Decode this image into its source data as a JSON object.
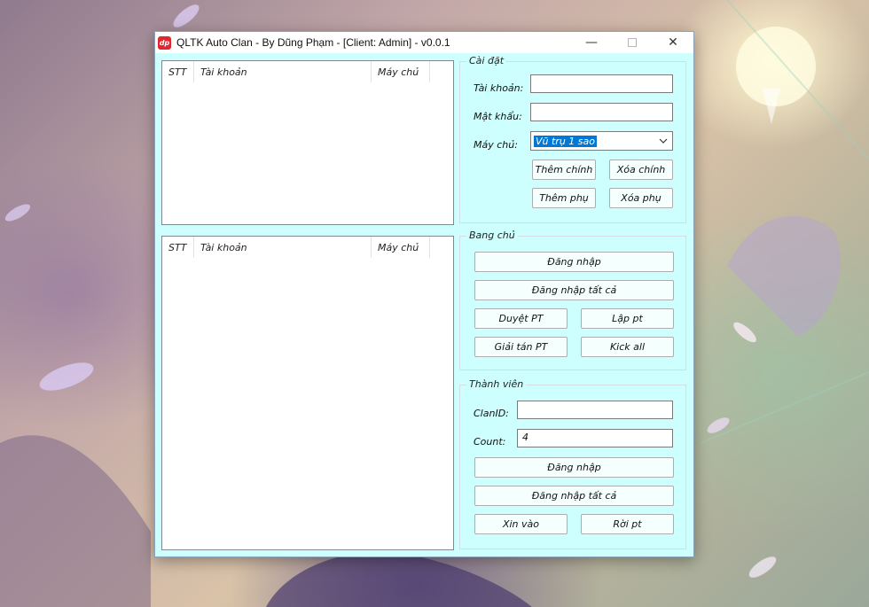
{
  "window": {
    "icon_text": "dp",
    "title": "QLTK Auto Clan - By Dũng Phạm - [Client: Admin] - v0.0.1",
    "minimize_glyph": "—",
    "close_glyph": "✕"
  },
  "list_main": {
    "columns": [
      "STT",
      "Tài khoản",
      "Máy chủ"
    ]
  },
  "list_members": {
    "columns": [
      "STT",
      "Tài khoản",
      "Máy chủ"
    ]
  },
  "settings": {
    "title": "Cài đặt",
    "account_label": "Tài khoản:",
    "account_value": "",
    "password_label": "Mật khẩu:",
    "password_value": "",
    "server_label": "Máy chủ:",
    "server_selected": "Vũ trụ 1 sao",
    "add_main": "Thêm chính",
    "delete_main": "Xóa chính",
    "add_sub": "Thêm phụ",
    "delete_sub": "Xóa phụ"
  },
  "leader": {
    "title": "Bang chủ",
    "login": "Đăng nhập",
    "login_all": "Đăng nhập tất cả",
    "approve_party": "Duyệt PT",
    "create_party": "Lập pt",
    "disband_party": "Giải tán PT",
    "kick_all": "Kick all"
  },
  "member": {
    "title": "Thành viên",
    "clanid_label": "ClanID:",
    "clanid_value": "",
    "count_label": "Count:",
    "count_value": "4",
    "login": "Đăng nhập",
    "login_all": "Đăng nhập tất cả",
    "request_join": "Xin vào",
    "leave_party": "Rời pt"
  },
  "colors": {
    "client_bg": "#ccfffe",
    "selection": "#0078d7",
    "icon_red": "#e3262e"
  }
}
